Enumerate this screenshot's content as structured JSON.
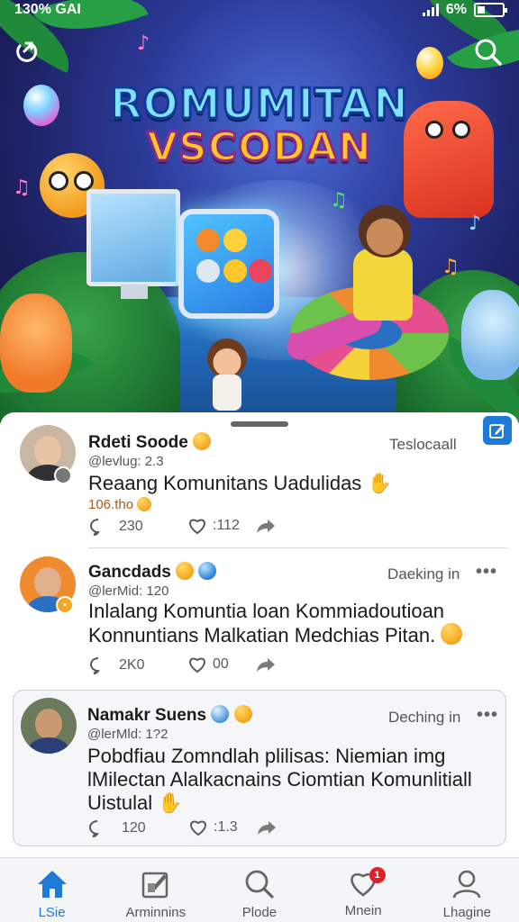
{
  "status_bar": {
    "left": "130% GAI",
    "battery": "6%"
  },
  "hero": {
    "title_line1": "ROMUMITAN",
    "title_line2": "VSCODAN"
  },
  "feed": {
    "posts": [
      {
        "author": "Rdeti Soode",
        "handle": "@levlug: 2.3",
        "time": "Teslocaall",
        "text": "Reaang Komunitans Uadulidas",
        "sub": "106.tho",
        "comments": "230",
        "likes": ":112"
      },
      {
        "author": "Gancdads",
        "handle": "@lerMid: 120",
        "time": "Daeking in",
        "text_line1": "Inlalang Komuntia loan Kommiadoutioan",
        "text_line2": "Konnuntians Malkatian Medchias Pitan.",
        "comments": "2K0",
        "likes": "00"
      },
      {
        "author": "Namakr Suens",
        "handle": "@lerMld: 1?2",
        "time": "Deching in",
        "text_line1": "Pobdfiau Zomndlah plilisas: Niemian img",
        "text_line2": "lMilectan Alalkacnains Ciomtian Komunlitiall",
        "text_line3": "Uistulal",
        "comments": "120",
        "likes": ":1.3"
      }
    ]
  },
  "nav": {
    "items": [
      {
        "label": "LSie",
        "icon": "home-icon"
      },
      {
        "label": "Arminnins",
        "icon": "edit-square-icon"
      },
      {
        "label": "Plode",
        "icon": "search-icon"
      },
      {
        "label": "Mnein",
        "icon": "heart-icon",
        "badge": "1"
      },
      {
        "label": "Lhagine",
        "icon": "profile-icon"
      }
    ]
  },
  "colors": {
    "accent": "#1f79d6",
    "badge": "#e2202a"
  }
}
